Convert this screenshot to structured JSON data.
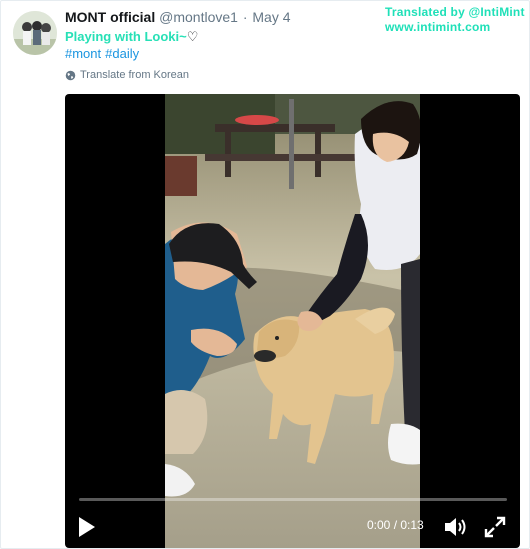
{
  "tweet": {
    "author_name": "MONT official",
    "author_handle": "@montlove1",
    "separator": "·",
    "date": "May 4",
    "text_main": "Playing with Looki~",
    "text_heart": "♡",
    "hashtags": [
      "#mont",
      "#daily"
    ],
    "translate_label": "Translate from Korean"
  },
  "watermark": {
    "line1": "Translated by @IntiMint",
    "line2": "www.intimint.com"
  },
  "video": {
    "time": "0:00 / 0:13",
    "progress": 0
  },
  "icons": {
    "avatar": "avatar-image",
    "translate": "globe-icon",
    "play": "play-icon",
    "volume": "volume-icon",
    "fullscreen": "fullscreen-icon"
  },
  "colors": {
    "link": "#1b95e0",
    "watermark": "#1fe0b8",
    "muted": "#657786"
  }
}
